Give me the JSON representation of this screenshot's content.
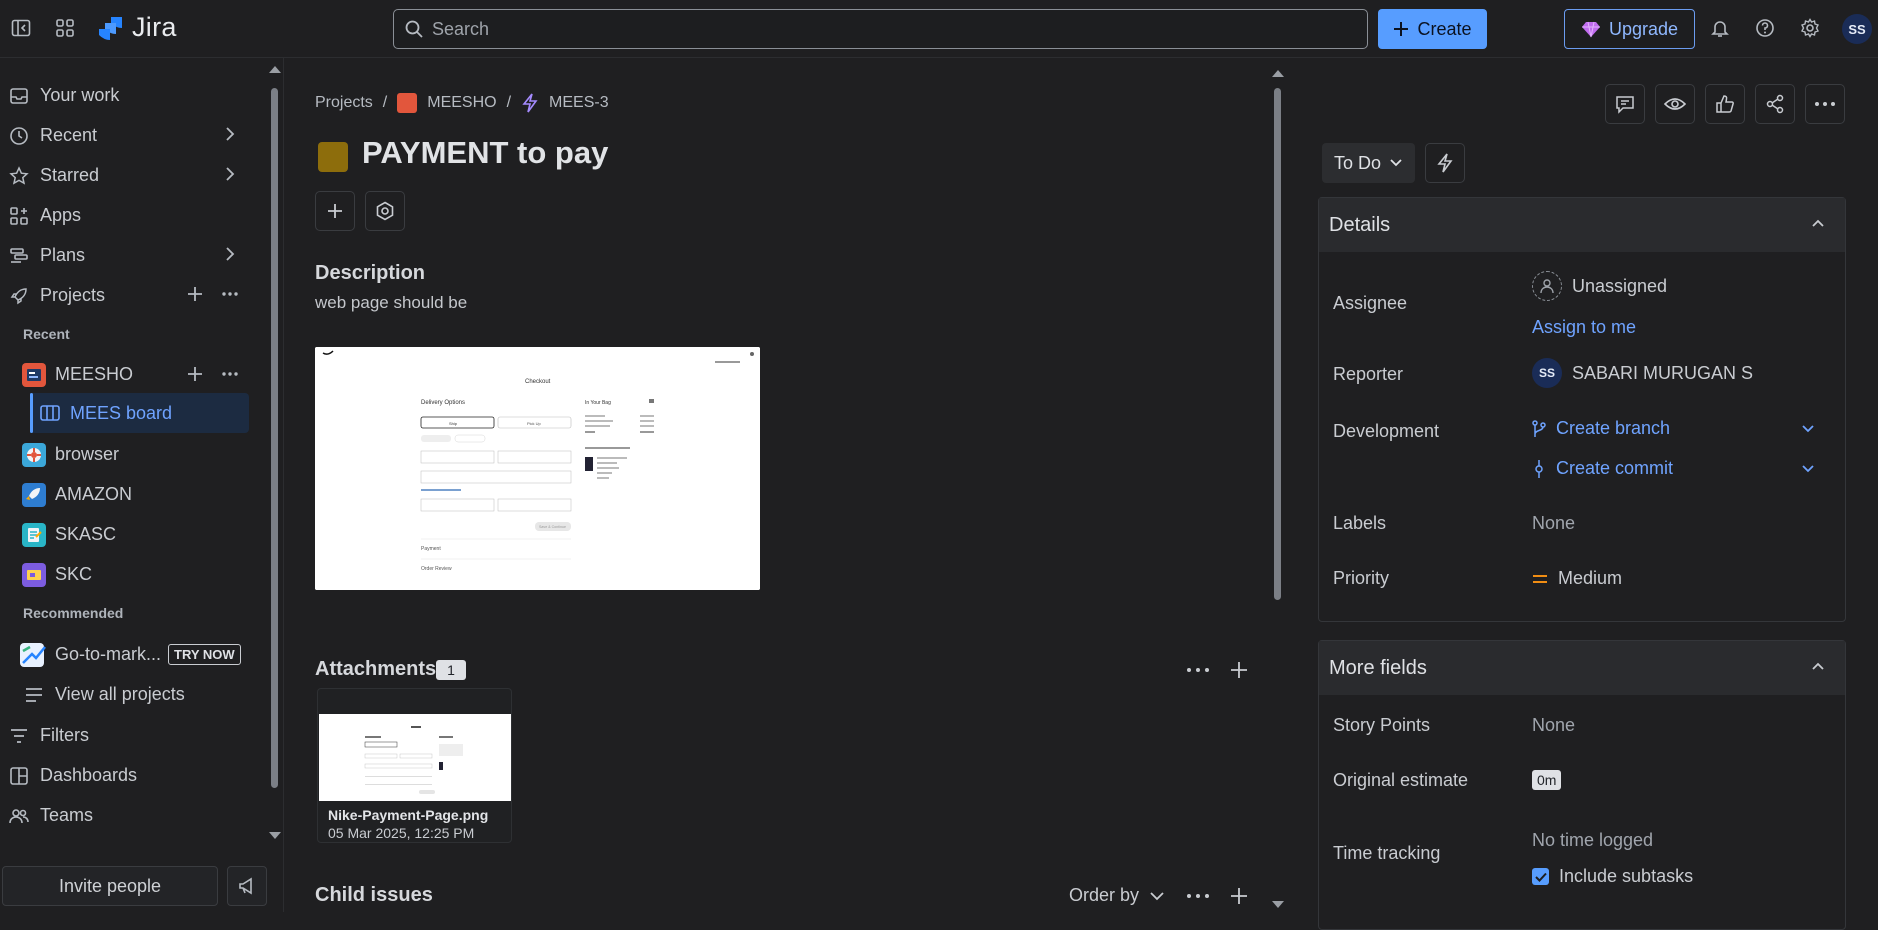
{
  "app": {
    "name": "Jira",
    "search_placeholder": "Search",
    "create_label": "Create",
    "upgrade_label": "Upgrade",
    "user_initials": "SS"
  },
  "sidebar": {
    "items": [
      {
        "label": "Your work",
        "icon": "inbox-icon"
      },
      {
        "label": "Recent",
        "icon": "clock-icon"
      },
      {
        "label": "Starred",
        "icon": "star-icon"
      },
      {
        "label": "Apps",
        "icon": "apps-icon"
      },
      {
        "label": "Plans",
        "icon": "plans-icon"
      },
      {
        "label": "Projects",
        "icon": "rocket-icon"
      }
    ],
    "recent_heading": "Recent",
    "projects": [
      {
        "label": "MEESHO",
        "color": "#e2563c"
      },
      {
        "label": "MEES board",
        "color": "#579dff"
      },
      {
        "label": "browser",
        "color": "#3ba7d9"
      },
      {
        "label": "AMAZON",
        "color": "#2e7dd1"
      },
      {
        "label": "SKASC",
        "color": "#29b5c7"
      },
      {
        "label": "SKC",
        "color": "#7c5ce0"
      }
    ],
    "recommended_heading": "Recommended",
    "recommended": {
      "label": "Go-to-mark...",
      "badge": "TRY NOW"
    },
    "view_all": "View all projects",
    "bottom_items": [
      {
        "label": "Filters",
        "icon": "filter-icon"
      },
      {
        "label": "Dashboards",
        "icon": "dashboard-icon"
      },
      {
        "label": "Teams",
        "icon": "teams-icon"
      }
    ],
    "invite_label": "Invite people"
  },
  "issue": {
    "breadcrumb": [
      "Projects",
      "MEESHO",
      "MEES-3"
    ],
    "title": "PAYMENT to pay",
    "description_heading": "Description",
    "description_text": "web page should be",
    "attachments_heading": "Attachments",
    "attachments_count": "1",
    "attachment": {
      "name": "Nike-Payment-Page.png",
      "date": "05 Mar 2025, 12:25 PM"
    },
    "child_heading": "Child issues",
    "order_by": "Order by"
  },
  "preview": {
    "store": "Checkout",
    "delivery": "Delivery Options",
    "ship": "Ship",
    "pickup": "Pick Up",
    "bag": "In Your Bag",
    "payment": "Payment",
    "review": "Order Review",
    "save": "Save & Continue"
  },
  "details": {
    "status": "To Do",
    "panel_title": "Details",
    "assignee_label": "Assignee",
    "assignee_value": "Unassigned",
    "assign_to_me": "Assign to me",
    "reporter_label": "Reporter",
    "reporter_initials": "SS",
    "reporter_value": "SABARI MURUGAN S",
    "development_label": "Development",
    "create_branch": "Create branch",
    "create_commit": "Create commit",
    "labels_label": "Labels",
    "labels_value": "None",
    "priority_label": "Priority",
    "priority_value": "Medium",
    "more_fields_title": "More fields",
    "story_points_label": "Story Points",
    "story_points_value": "None",
    "original_estimate_label": "Original estimate",
    "original_estimate_value": "0m",
    "time_tracking_label": "Time tracking",
    "time_tracking_value": "No time logged",
    "include_subtasks": "Include subtasks"
  }
}
